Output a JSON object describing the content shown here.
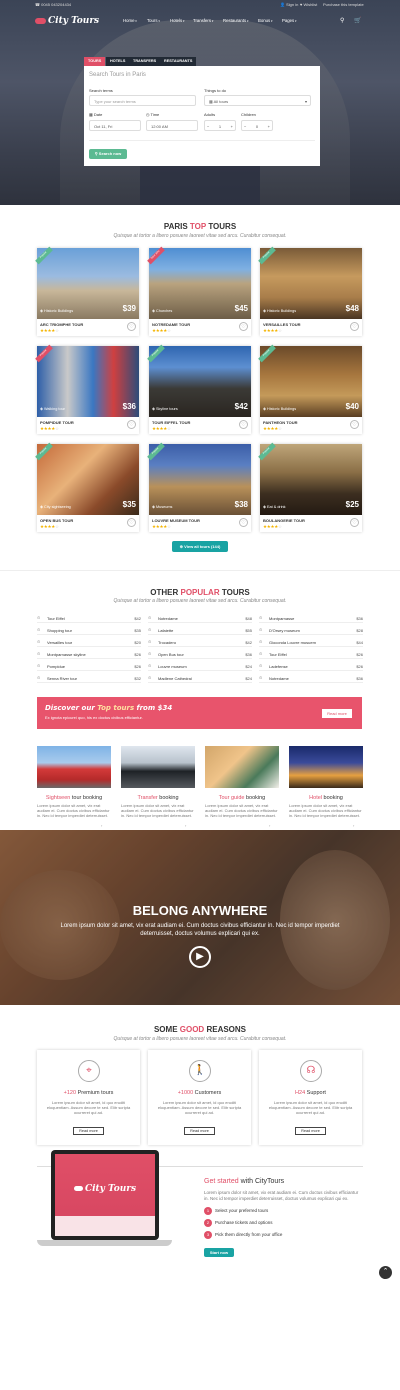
{
  "topbar": {
    "phone": "0045 043204434",
    "sign_in": "Sign in",
    "wishlist": "Wishlist",
    "purchase": "Purchase this template"
  },
  "brand": {
    "name": "City Tours"
  },
  "nav": [
    "Home",
    "Tours",
    "Hotels",
    "Transfers",
    "Restaurants",
    "Bonus",
    "Pages"
  ],
  "search": {
    "tabs": [
      "TOURS",
      "HOTELS",
      "TRANSFERS",
      "RESTAURANTS"
    ],
    "title": "Search Tours in Paris",
    "search_terms_label": "Search terms",
    "search_terms_placeholder": "Type your search terms",
    "things_label": "Things to do",
    "things_value": "All tours",
    "date_label": "Date",
    "date_value": "Oct 11, Fri",
    "time_label": "Time",
    "time_value": "12:00 AM",
    "adults_label": "Adults",
    "adults_value": "1",
    "children_label": "Children",
    "children_value": "0",
    "button": "Search now"
  },
  "paris_tours": {
    "title_a": "PARIS",
    "title_b": "TOP",
    "title_c": "TOURS",
    "subtitle": "Quisque at tortor a libero posuere laoreet vitae sed arcu. Curabitur consequat.",
    "cards": [
      {
        "category": "Historic Buildings",
        "price": "$39",
        "name": "ARC TRIOMPHE TOUR",
        "ribbon": "Popular",
        "stars": 4
      },
      {
        "category": "Churches",
        "price": "$45",
        "name": "NOTREDAME TOUR",
        "ribbon": "Save 30%",
        "stars": 4
      },
      {
        "category": "Historic Buildings",
        "price": "$48",
        "name": "VERSAILLES TOUR",
        "ribbon": "Popular",
        "stars": 4
      },
      {
        "category": "Walking tour",
        "price": "$36",
        "name": "POMPIDUE TOUR",
        "ribbon": "Popular",
        "stars": 4
      },
      {
        "category": "Skyline tours",
        "price": "$42",
        "name": "TOUR EIFFEL TOUR",
        "ribbon": "Popular",
        "stars": 4
      },
      {
        "category": "Historic Buildings",
        "price": "$40",
        "name": "PANTHEON TOUR",
        "ribbon": "Popular",
        "stars": 4
      },
      {
        "category": "City sightseeing",
        "price": "$35",
        "name": "OPEN BUS TOUR",
        "ribbon": "Popular",
        "stars": 4
      },
      {
        "category": "Museums",
        "price": "$38",
        "name": "LOUVRE MUSEUM TOUR",
        "ribbon": "Popular",
        "stars": 4
      },
      {
        "category": "Eat & drink",
        "price": "$25",
        "name": "BOULANGERIE TOUR",
        "ribbon": "Popular",
        "stars": 4
      }
    ],
    "view_all": "View all tours (144)"
  },
  "popular": {
    "title_a": "OTHER",
    "title_b": "POPULAR",
    "title_c": "TOURS",
    "subtitle": "Quisque at tortor a libero posuere laoreet vitae sed arcu. Curabitur consequat.",
    "columns": [
      [
        {
          "name": "Tour Eiffel",
          "price": "$42"
        },
        {
          "name": "Shopping tour",
          "price": "$35"
        },
        {
          "name": "Versailles tour",
          "price": "$20"
        },
        {
          "name": "Montparnasse skyline",
          "price": "$26"
        },
        {
          "name": "Pompidue",
          "price": "$26"
        },
        {
          "name": "Senna River tour",
          "price": "$32"
        }
      ],
      [
        {
          "name": "Notredame",
          "price": "$48"
        },
        {
          "name": "Lafaiette",
          "price": "$55"
        },
        {
          "name": "Trocadero",
          "price": "$42"
        },
        {
          "name": "Open Bus tour",
          "price": "$36"
        },
        {
          "name": "Louvre museum",
          "price": "$24"
        },
        {
          "name": "Madlene Cathedral",
          "price": "$24"
        }
      ],
      [
        {
          "name": "Montparnasse",
          "price": "$36"
        },
        {
          "name": "D'Orsey museum",
          "price": "$28"
        },
        {
          "name": "Gioconda Louvre musuem",
          "price": "$44"
        },
        {
          "name": "Tour Eiffel",
          "price": "$26"
        },
        {
          "name": "Ladefense",
          "price": "$26"
        },
        {
          "name": "Notredame",
          "price": "$36"
        }
      ]
    ]
  },
  "banner": {
    "text_a": "Discover our",
    "text_b": "Top tours",
    "text_c": "from $34",
    "sub": "Ex ignota epicurei quo, his ex doctus civibus efficiantur.",
    "button": "Read more"
  },
  "services": [
    {
      "hl": "Sightseen",
      "rest": " tour booking",
      "desc": "Lorem ipsum dolor sit amet, vix erat audiam ei. Cum doctus civibus efficiantur in. Nec id tempor imperdiet deterruisset.",
      "link": "Read more"
    },
    {
      "hl": "Transfer",
      "rest": " booking",
      "desc": "Lorem ipsum dolor sit amet, vix erat audiam ei. Cum doctus civibus efficiantur in. Nec id tempor imperdiet deterruisset.",
      "link": "Read more"
    },
    {
      "hl": "Tour guide",
      "rest": " booking",
      "desc": "Lorem ipsum dolor sit amet, vix erat audiam ei. Cum doctus civibus efficiantur in. Nec id tempor imperdiet deterruisset.",
      "link": "Read more"
    },
    {
      "hl": "Hotel",
      "rest": " booking",
      "desc": "Lorem ipsum dolor sit amet, vix erat audiam ei. Cum doctus civibus efficiantur in. Nec id tempor imperdiet deterruisset.",
      "link": "Read more"
    }
  ],
  "video": {
    "title": "BELONG ANYWHERE",
    "text": "Lorem ipsum dolor sit amet, vix erat audiam ei. Cum doctus civibus efficiantur in. Nec id tempor imperdiet deterruisset, doctus volumus explicari qui ex."
  },
  "reasons": {
    "title_a": "SOME",
    "title_b": "GOOD",
    "title_c": "REASONS",
    "subtitle": "Quisque at tortor a libero posuere laoreet vitae sed arcu. Curabitur consequat.",
    "items": [
      {
        "icon": "map-pin-icon",
        "hl": "+120",
        "rest": " Premium tours",
        "desc": "Lorem ipsum dolor sit amet, id quo eruditi eloquentiam. Assum decore te sed. Elitr scripta ocurreret qui ad.",
        "button": "Read more"
      },
      {
        "icon": "walking-person-icon",
        "hl": "+1000",
        "rest": " Customers",
        "desc": "Lorem ipsum dolor sit amet, id quo eruditi eloquentiam. Assum decore te sed. Elitr scripta ocurreret qui ad.",
        "button": "Read more"
      },
      {
        "icon": "headset-icon",
        "hl": "H24",
        "rest": " Support",
        "desc": "Lorem ipsum dolor sit amet, id quo eruditi eloquentiam. Assum decore te sed. Elitr scripta ocurreret qui ad.",
        "button": "Read more"
      }
    ]
  },
  "getstarted": {
    "title_hl": "Get started",
    "title_rest": " with CityTours",
    "desc": "Lorem ipsum dolor sit amet, vix erat audiam ei. Cum doctus civibus efficiantur in. Nec id tempor imperdiet deterruisset, doctus volumus explicari qui ex.",
    "steps": [
      "Select your preferred tours",
      "Purchase tickets and options",
      "Pick them directly from your office"
    ],
    "button": "Start now",
    "screen_logo": "City Tours"
  },
  "colors": {
    "accent": "#e04f67",
    "green": "#5cba92",
    "teal": "#19a3a3",
    "star": "#f4b400"
  }
}
